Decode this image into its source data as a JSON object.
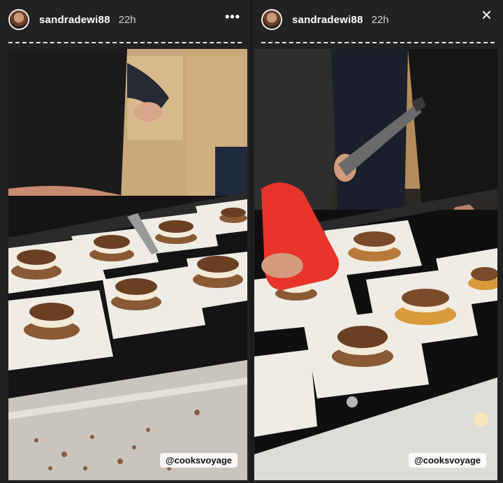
{
  "stories": [
    {
      "username": "sandradewi88",
      "time": "22h",
      "more_icon": "•••",
      "tag": "@cooksvoyage"
    },
    {
      "username": "sandradewi88",
      "time": "22h",
      "more_icon": "•••",
      "close_icon": "×",
      "tag": "@cooksvoyage"
    }
  ],
  "colors": {
    "plate": "#f2f0ec",
    "dessert": "#7a4b2a",
    "cream": "#f3ead8",
    "counter": "#111111",
    "bottle": "#e8342a"
  }
}
